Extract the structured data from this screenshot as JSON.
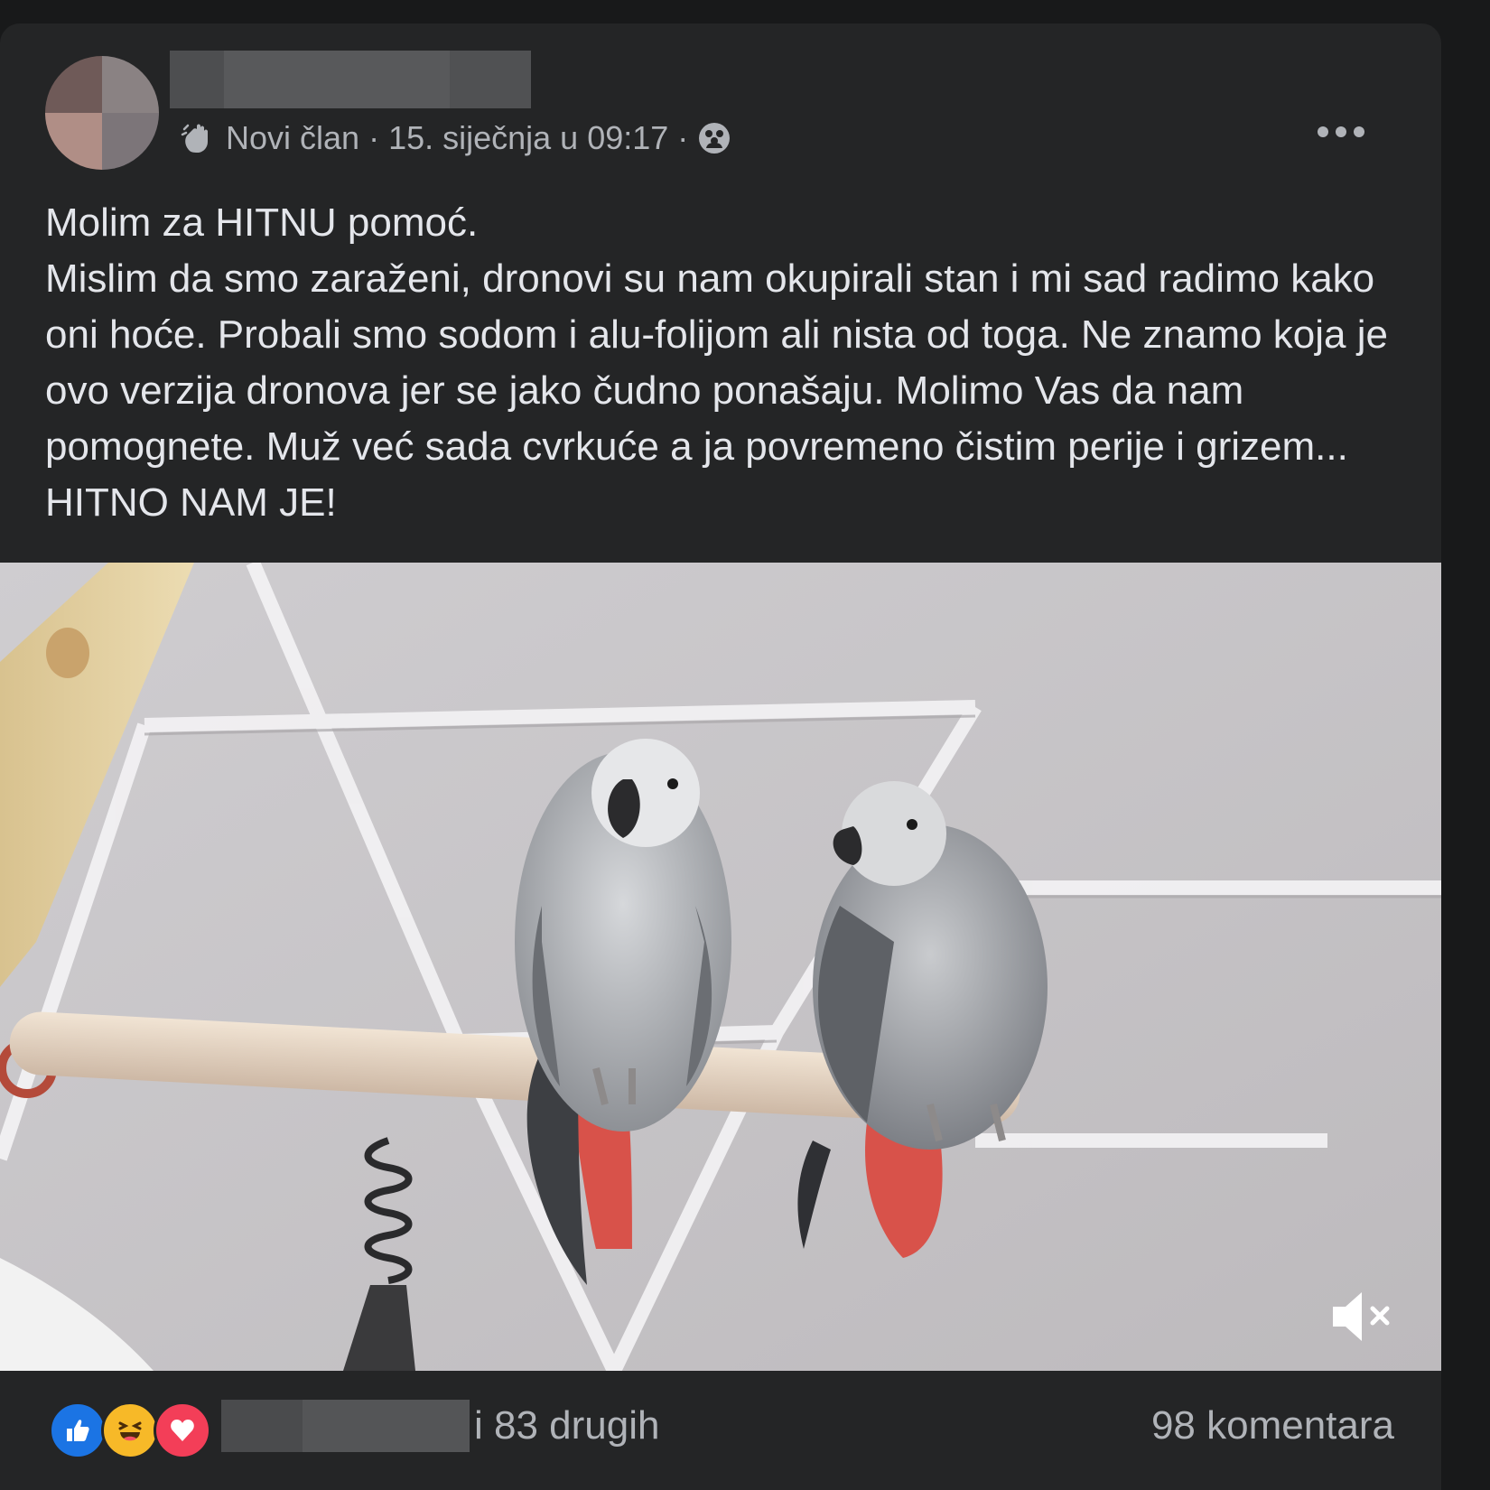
{
  "post": {
    "author_badge": "Novi član",
    "separator": "·",
    "timestamp": "15. siječnja u 09:17",
    "separator2": "·",
    "audience_icon": "group-members-icon",
    "badge_icon": "waving-hand-icon",
    "more_icon": "more-options-icon",
    "text_lines": [
      "Molim za HITNU pomoć.",
      "Mislim da smo zaraženi, dronovi su nam okupirali stan i mi sad radimo kako oni hoće. Probali smo sodom i alu-folijom ali nista od toga. Ne znamo koja je ovo verzija dronova jer se jako čudno ponašaju. Molimo Vas da nam pomognete. Muž već sada cvrkuće a ja povremeno čistim perije i grizem... HITNO NAM JE!"
    ],
    "media_icon": "muted-speaker-icon"
  },
  "footer": {
    "reactions": [
      "like-icon",
      "haha-icon",
      "love-icon"
    ],
    "others_text": "i 83 drugih",
    "comments_text": "98 komentara"
  },
  "colors": {
    "background": "#18191a",
    "card": "#242526",
    "text_primary": "#e4e6eb",
    "text_secondary": "#b0b3b8",
    "like": "#1b74e4",
    "haha": "#f7b928",
    "love": "#f33e58"
  }
}
